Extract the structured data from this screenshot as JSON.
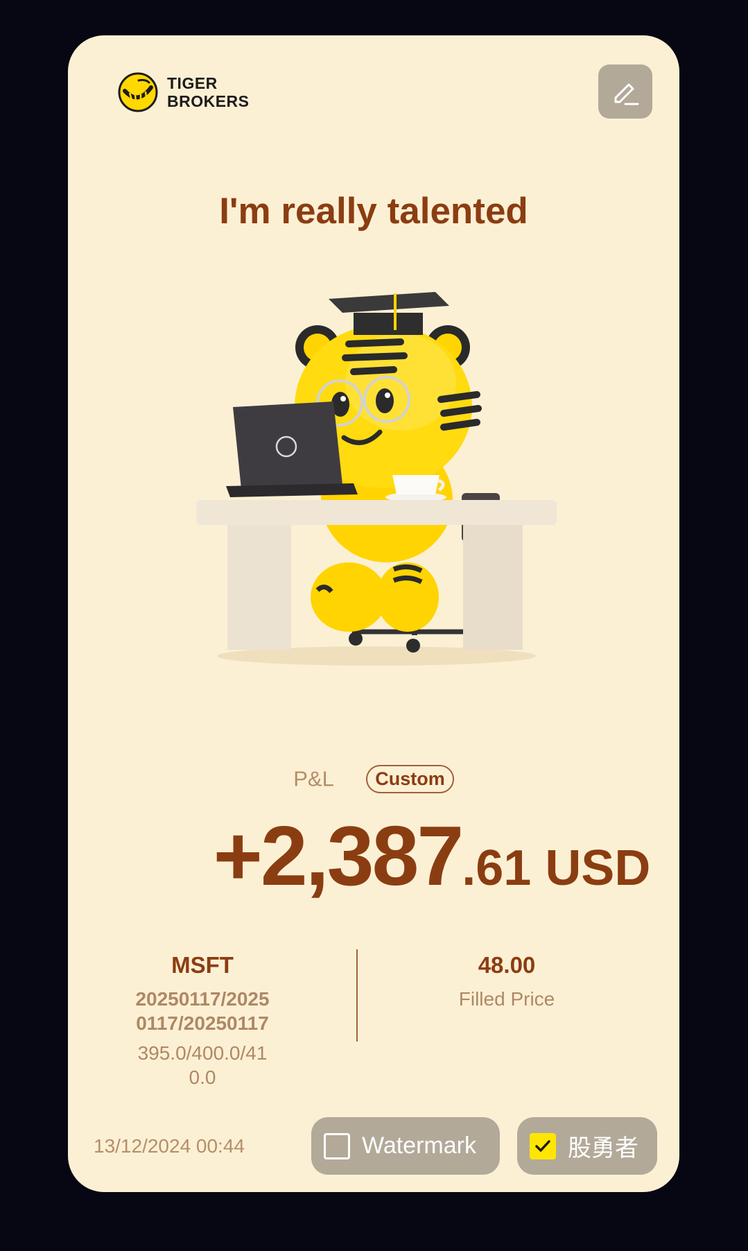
{
  "brand": {
    "line1": "TIGER",
    "line2": "BROKERS"
  },
  "headline": "I'm really talented",
  "pnl": {
    "label": "P&L",
    "mode_badge": "Custom",
    "amount_main": "+2,387",
    "amount_fraction": ".61 USD"
  },
  "position": {
    "symbol": "MSFT",
    "expiries": "20250117/20250117/20250117",
    "strikes": "395.0/400.0/410.0",
    "price_value": "48.00",
    "price_label": "Filled Price"
  },
  "timestamp": "13/12/2024 00:44",
  "toggles": {
    "watermark": {
      "label": "Watermark",
      "checked": false
    },
    "nickname": {
      "label": "股勇者",
      "checked": true
    }
  },
  "icons": {
    "edit": "edit-pencil-icon",
    "logo": "tiger-logo-icon",
    "check": "check-icon"
  },
  "colors": {
    "card_bg": "#fcf0d4",
    "accent_brown": "#8b3d12",
    "muted_brown": "#b48e6a",
    "toggle_bg": "#b2a999",
    "check_yellow": "#ffe600",
    "backdrop": "#060713"
  }
}
